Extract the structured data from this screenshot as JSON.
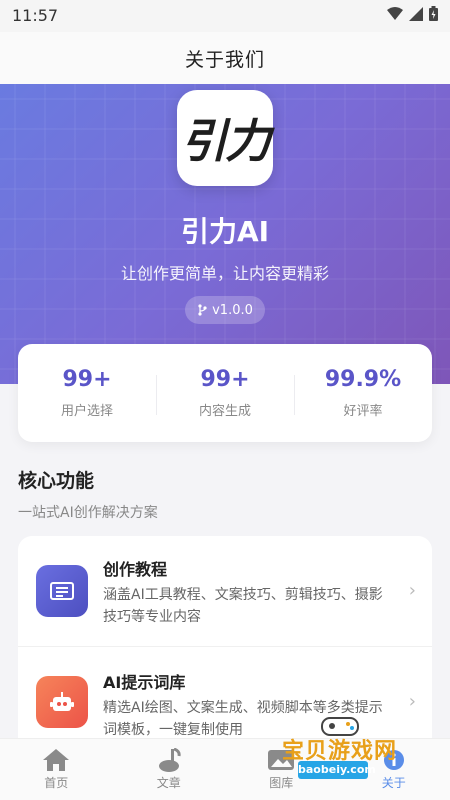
{
  "status_bar": {
    "time": "11:57"
  },
  "nav": {
    "title": "关于我们"
  },
  "hero": {
    "logo_text": "引力",
    "app_name": "引力AI",
    "slogan": "让创作更简单，让内容更精彩",
    "version": "v1.0.0"
  },
  "stats": [
    {
      "value": "99+",
      "label": "用户选择"
    },
    {
      "value": "99+",
      "label": "内容生成"
    },
    {
      "value": "99.9%",
      "label": "好评率"
    }
  ],
  "section": {
    "title": "核心功能",
    "subtitle": "一站式AI创作解决方案"
  },
  "features": [
    {
      "title": "创作教程",
      "desc": "涵盖AI工具教程、文案技巧、剪辑技巧、摄影技巧等专业内容",
      "icon": "book-icon",
      "color": "#5b5fd0"
    },
    {
      "title": "AI提示词库",
      "desc": "精选AI绘图、文案生成、视频脚本等多类提示词模板，一键复制使用",
      "icon": "robot-icon",
      "color": "#f26a4f"
    }
  ],
  "tabs": [
    {
      "label": "首页",
      "icon": "home-icon"
    },
    {
      "label": "文章",
      "icon": "music-note-icon"
    },
    {
      "label": "图库",
      "icon": "image-icon"
    },
    {
      "label": "关于",
      "icon": "info-icon",
      "active": true
    }
  ],
  "watermark": {
    "text": "宝贝游戏网",
    "url": "baobeiy.com"
  },
  "colors": {
    "accent": "#5a55c8",
    "hero_start": "#6a7be0",
    "hero_end": "#7e56b8",
    "tab_active": "#5a8de8"
  }
}
